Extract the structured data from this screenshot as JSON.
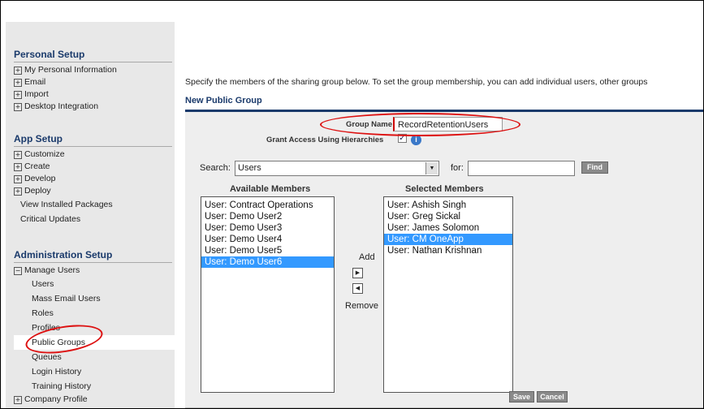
{
  "sidebar": {
    "personal": {
      "title": "Personal Setup",
      "items": [
        "My Personal Information",
        "Email",
        "Import",
        "Desktop Integration"
      ]
    },
    "app": {
      "title": "App Setup",
      "items": [
        "Customize",
        "Create",
        "Develop",
        "Deploy"
      ],
      "links": [
        "View Installed Packages",
        "Critical Updates"
      ]
    },
    "admin": {
      "title": "Administration Setup",
      "manage_users": "Manage Users",
      "subitems": [
        "Users",
        "Mass Email Users",
        "Roles",
        "Profiles",
        "Public Groups",
        "Queues",
        "Login History",
        "Training History"
      ],
      "company_profile": "Company Profile"
    }
  },
  "main": {
    "intro": "Specify the members of the sharing group below. To set the group membership, you can add individual users, other groups",
    "section_title": "New Public Group"
  },
  "form": {
    "group_name_label": "Group Name",
    "group_name_value": "RecordRetentionUsers",
    "grant_access_label": "Grant Access Using Hierarchies",
    "grant_access_checked": "✓",
    "info_icon": "i",
    "search_label": "Search:",
    "search_value": "Users",
    "for_label": "for:",
    "for_value": "",
    "find_button": "Find"
  },
  "members": {
    "available_title": "Available Members",
    "selected_title": "Selected Members",
    "available": [
      "User: Contract Operations",
      "User: Demo User2",
      "User: Demo User3",
      "User: Demo User4",
      "User: Demo User5",
      "User: Demo User6"
    ],
    "available_selected_index": 5,
    "selected": [
      "User: Ashish Singh",
      "User: Greg Sickal",
      "User: James Solomon",
      "User: CM OneApp",
      "User: Nathan Krishnan"
    ],
    "selected_selected_index": 3,
    "add_label": "Add",
    "remove_label": "Remove"
  },
  "buttons": {
    "save": "Save",
    "cancel": "Cancel"
  },
  "colors": {
    "header_blue": "#1a3a6b",
    "selection_blue": "#3399ff",
    "annotation_red": "#dd1111",
    "sidebar_bg": "#e8e8e8"
  }
}
